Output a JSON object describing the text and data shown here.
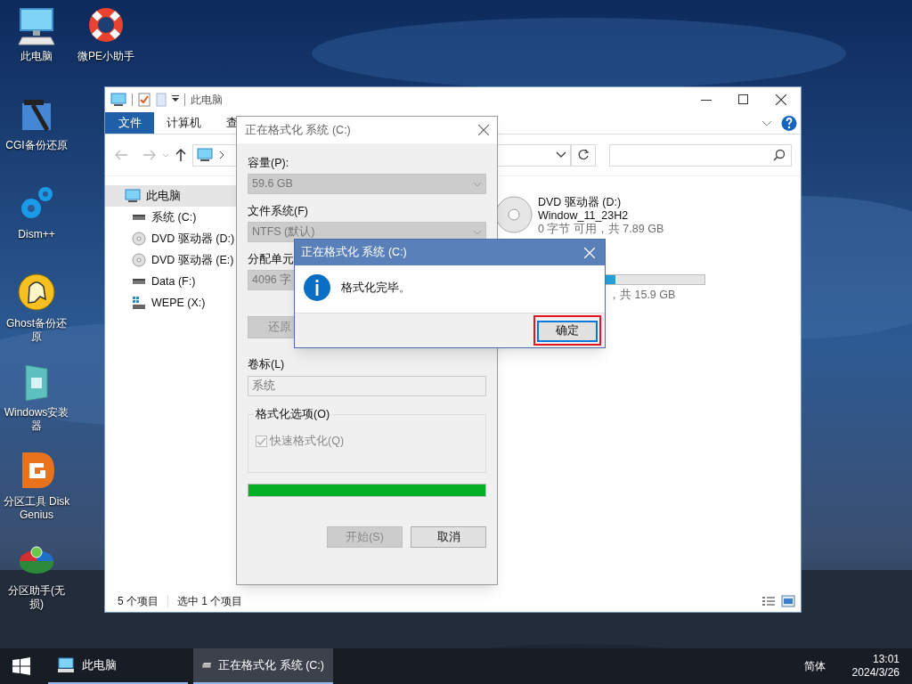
{
  "desktop_icons": [
    {
      "label": "此电脑",
      "kind": "monitor"
    },
    {
      "label": "CGI备份还原",
      "kind": "hammer"
    },
    {
      "label": "Dism++",
      "kind": "gears"
    },
    {
      "label": "Ghost备份还原",
      "kind": "ghost"
    },
    {
      "label": "Windows安装器",
      "kind": "installer"
    },
    {
      "label": "分区工具 DiskGenius",
      "kind": "diskgenius"
    },
    {
      "label": "分区助手(无损)",
      "kind": "partition"
    },
    {
      "label": "微PE小助手",
      "kind": "lifebuoy"
    }
  ],
  "explorer": {
    "title": "此电脑",
    "ribbon_tabs": [
      {
        "label": "文件",
        "selected": true
      },
      {
        "label": "计算机",
        "selected": false
      },
      {
        "label": "查",
        "selected": false
      }
    ],
    "nav_tree": [
      {
        "label": "此电脑",
        "kind": "computer",
        "selected": true,
        "children": [
          {
            "label": "系统 (C:)",
            "kind": "disk",
            "selected": false
          },
          {
            "label": "DVD 驱动器 (D:)",
            "kind": "dvd",
            "selected": false
          },
          {
            "label": "DVD 驱动器 (E:)",
            "kind": "dvd",
            "selected": false
          },
          {
            "label": "Data (F:)",
            "kind": "disk",
            "selected": false
          },
          {
            "label": "WEPE (X:)",
            "kind": "wepe",
            "selected": false
          }
        ]
      }
    ],
    "drives": [
      {
        "kind": "dvd",
        "name": "DVD 驱动器 (D:)",
        "volume": "Window_11_23H2",
        "info": "0 字节 可用，共 7.89 GB"
      },
      {
        "kind": "disk",
        "level": 0.46,
        "info": "，共 15.9 GB"
      }
    ],
    "status_bar": [
      "5 个项目",
      "选中 1 个项目"
    ]
  },
  "format_dialog": {
    "title": "正在格式化 系统 (C:)",
    "fields": [
      {
        "label": "容量(P):",
        "value": "59.6 GB",
        "kind": "dropdown"
      },
      {
        "label": "文件系统(F)",
        "value": "NTFS (默认)",
        "kind": "dropdown"
      },
      {
        "label": "分配单元",
        "value": "4096 字",
        "kind": "dropdown"
      }
    ],
    "restore_button": "还原",
    "volume_label": {
      "label": "卷标(L)",
      "value": "系统"
    },
    "options_group": "格式化选项(O)",
    "quick_format": {
      "label": "快速格式化(Q)",
      "checked": true,
      "disabled": true
    },
    "progress": {
      "level": 1
    },
    "buttons": [
      {
        "label": "开始(S)",
        "disabled": true
      },
      {
        "label": "取消",
        "disabled": false
      }
    ]
  },
  "message_box": {
    "title": "正在格式化 系统 (C:)",
    "text": "格式化完毕。",
    "button": "确定",
    "highlighted": true
  },
  "taskbar": {
    "items": [
      {
        "label": "此电脑",
        "kind": "computer",
        "selected": false
      },
      {
        "label": "正在格式化 系统 (C:)",
        "kind": "disk",
        "selected": true
      }
    ],
    "ime": "简体",
    "time": "13:01",
    "date": "2024/3/26"
  }
}
